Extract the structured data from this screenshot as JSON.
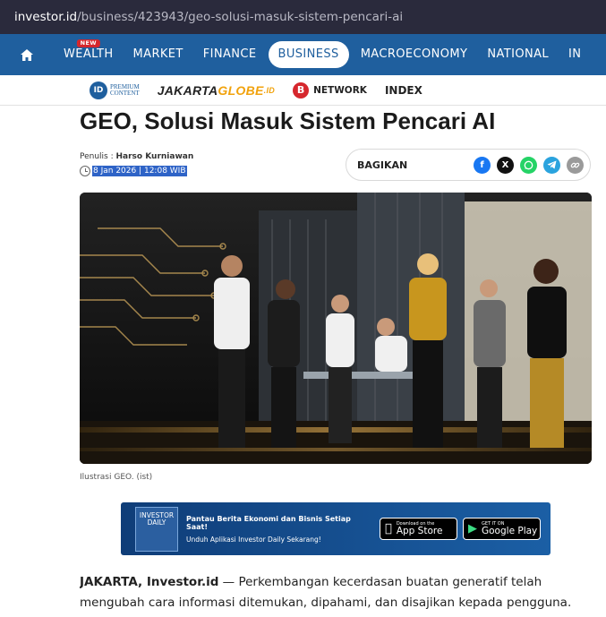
{
  "browser": {
    "host": "investor.id",
    "path": "/business/423943/geo-solusi-masuk-sistem-pencari-ai"
  },
  "nav": {
    "items": [
      {
        "label": "WEALTH",
        "badge": "NEW"
      },
      {
        "label": "MARKET"
      },
      {
        "label": "FINANCE"
      },
      {
        "label": "BUSINESS",
        "active": true
      },
      {
        "label": "MACROECONOMY"
      },
      {
        "label": "NATIONAL"
      },
      {
        "label": "IN"
      }
    ],
    "home_icon": "home-icon"
  },
  "subnav": {
    "premium_line1": "PREMIUM",
    "premium_line2": "CONTENT",
    "premium_badge": "ID",
    "jakarta": "JAKARTA",
    "globe": "GLOBE",
    "globe_suffix": ".ID",
    "bnetwork_letter": "B",
    "bnetwork": "NETWORK",
    "index": "INDEX"
  },
  "article": {
    "title": "GEO, Solusi Masuk Sistem Pencari AI",
    "author_prefix": "Penulis : ",
    "author": "Harso Kurniawan",
    "date": "8 Jan 2026 | 12:08 WIB",
    "share_label": "BAGIKAN",
    "share_icons": [
      "facebook-icon",
      "x-icon",
      "whatsapp-icon",
      "telegram-icon",
      "link-icon"
    ],
    "caption": "Ilustrasi GEO. (ist)",
    "lead_bold": "JAKARTA, Investor.id",
    "lead_rest": " — Perkembangan kecerdasan buatan generatif telah",
    "line2": "mengubah cara informasi ditemukan, dipahami, dan disajikan kepada pengguna."
  },
  "banner": {
    "logo_line1": "INVESTOR",
    "logo_line2": "DAILY",
    "headline": "Pantau Berita Ekonomi dan Bisnis Setiap Saat!",
    "sub": "Unduh Aplikasi Investor Daily Sekarang!",
    "appstore_small": "Download on the",
    "appstore": "App Store",
    "gplay_small": "GET IT ON",
    "gplay": "Google Play"
  },
  "colors": {
    "brand": "#1f5f9e",
    "badge": "#d6272d",
    "accent": "#f1a20c"
  }
}
